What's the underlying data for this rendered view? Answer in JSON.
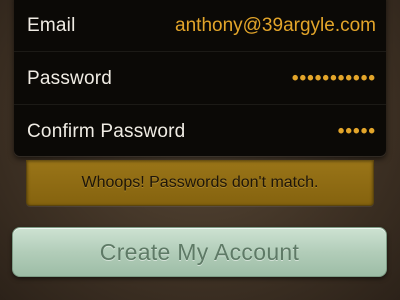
{
  "form": {
    "email": {
      "label": "Email",
      "value": "anthony@39argyle.com"
    },
    "password": {
      "label": "Password",
      "value": "•••••••••••"
    },
    "confirm_password": {
      "label": "Confirm Password",
      "value": "•••••"
    }
  },
  "error": {
    "message": "Whoops! Passwords don't match."
  },
  "actions": {
    "create_account_label": "Create My Account"
  },
  "colors": {
    "field_value": "#e3a52a",
    "error_background": "#8f6b13",
    "button_background": "#b2cdb9"
  }
}
